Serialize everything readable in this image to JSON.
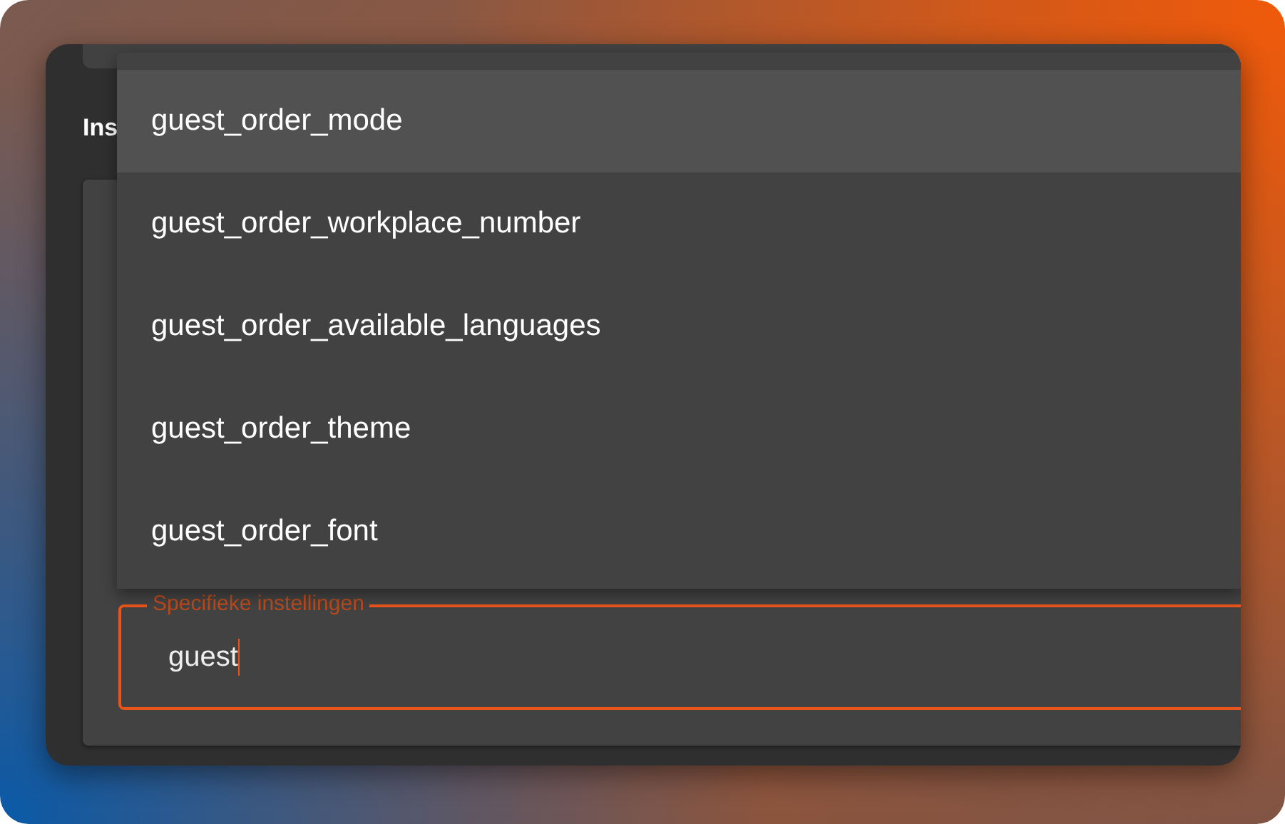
{
  "heading": "Ins",
  "field": {
    "label": "Specifieke instellingen",
    "value": "guest",
    "focused": true
  },
  "menu": {
    "items": [
      {
        "label": "guest_order_mode",
        "selected": true
      },
      {
        "label": "guest_order_workplace_number",
        "selected": false
      },
      {
        "label": "guest_order_available_languages",
        "selected": false
      },
      {
        "label": "guest_order_theme",
        "selected": false
      },
      {
        "label": "guest_order_font",
        "selected": false
      }
    ]
  }
}
